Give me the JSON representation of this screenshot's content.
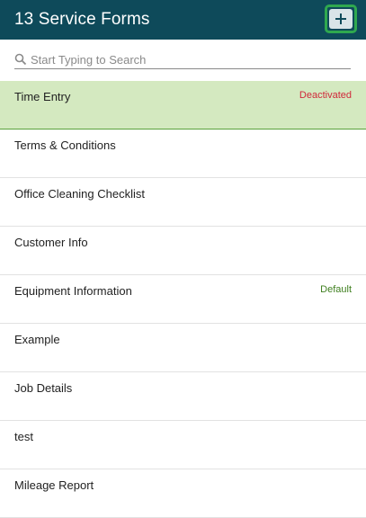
{
  "header": {
    "title": "13 Service Forms",
    "add_button_label": "+"
  },
  "search": {
    "placeholder": "Start Typing to Search",
    "value": ""
  },
  "colors": {
    "header_bg": "#0e4a5a",
    "active_row_bg": "#d4e9c0",
    "deactivated": "#d0283a",
    "default": "#3f7f1f",
    "highlight_border": "#2fa84f"
  },
  "forms": [
    {
      "label": "Time Entry",
      "status": "Deactivated",
      "status_color": "#d0283a",
      "active": true
    },
    {
      "label": "Terms & Conditions",
      "status": "",
      "status_color": "",
      "active": false
    },
    {
      "label": "Office Cleaning Checklist",
      "status": "",
      "status_color": "",
      "active": false
    },
    {
      "label": "Customer Info",
      "status": "",
      "status_color": "",
      "active": false
    },
    {
      "label": "Equipment Information",
      "status": "Default",
      "status_color": "#3f7f1f",
      "active": false
    },
    {
      "label": "Example",
      "status": "",
      "status_color": "",
      "active": false
    },
    {
      "label": "Job Details",
      "status": "",
      "status_color": "",
      "active": false
    },
    {
      "label": "test",
      "status": "",
      "status_color": "",
      "active": false
    },
    {
      "label": "Mileage Report",
      "status": "",
      "status_color": "",
      "active": false
    }
  ]
}
